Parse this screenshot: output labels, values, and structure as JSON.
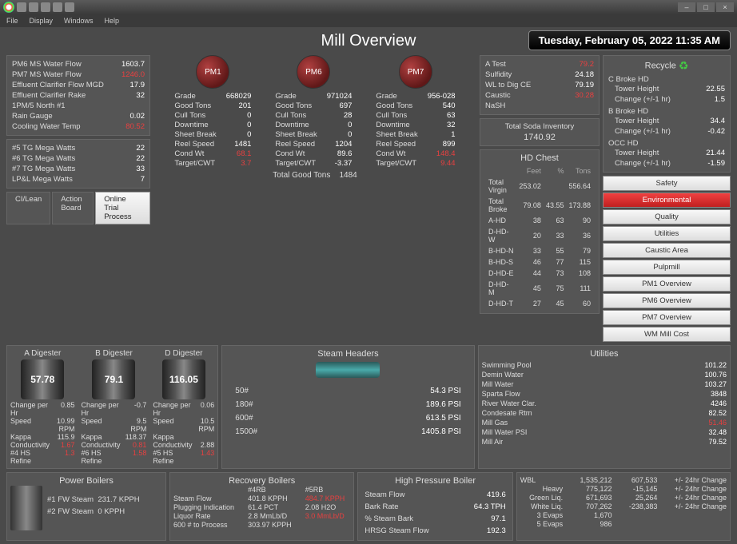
{
  "menu": {
    "file": "File",
    "display": "Display",
    "windows": "Windows",
    "help": "Help"
  },
  "title": "Mill Overview",
  "clock": "Tuesday, February 05, 2022 11:35 AM",
  "left": [
    {
      "l": "PM6 MS Water Flow",
      "v": "1603.7"
    },
    {
      "l": "PM7 MS Water Flow",
      "v": "1246.0",
      "red": true
    },
    {
      "l": "Effluent Clarifier Flow MGD",
      "v": "17.9"
    },
    {
      "l": "Effluent Clarifier Rake",
      "v": "32"
    },
    {
      "l": "1PM/5 North #1",
      "v": "",
      "red": true
    },
    {
      "l": "Rain Gauge",
      "v": "0.02"
    },
    {
      "l": "Cooling Water Temp",
      "v": "80.52",
      "red": true
    }
  ],
  "left2": [
    {
      "l": "#5 TG Mega Watts",
      "v": "22"
    },
    {
      "l": "#6 TG Mega Watts",
      "v": "22"
    },
    {
      "l": "#7 TG Mega Watts",
      "v": "33"
    },
    {
      "l": "LP&L Mega Watts",
      "v": "7"
    }
  ],
  "pm": [
    {
      "name": "PM1",
      "grade": "668029",
      "rows": [
        [
          "Good Tons",
          "201"
        ],
        [
          "Cull Tons",
          "0"
        ],
        [
          "Downtime",
          "0"
        ],
        [
          "Sheet Break",
          "0"
        ],
        [
          "Reel Speed",
          "1481"
        ],
        [
          "Cond Wt",
          "68.1",
          "red"
        ],
        [
          "Target/CWT",
          "3.7",
          "red"
        ]
      ]
    },
    {
      "name": "PM6",
      "grade": "971024",
      "rows": [
        [
          "Good Tons",
          "697"
        ],
        [
          "Cull Tons",
          "28"
        ],
        [
          "Downtime",
          "0"
        ],
        [
          "Sheet Break",
          "0"
        ],
        [
          "Reel Speed",
          "1204"
        ],
        [
          "Cond Wt",
          "89.6"
        ],
        [
          "Target/CWT",
          "-3.37"
        ]
      ]
    },
    {
      "name": "PM7",
      "grade": "956-028",
      "rows": [
        [
          "Good Tons",
          "540"
        ],
        [
          "Cull Tons",
          "63"
        ],
        [
          "Downtime",
          "32"
        ],
        [
          "Sheet Break",
          "1"
        ],
        [
          "Reel Speed",
          "899"
        ],
        [
          "Cond Wt",
          "148.4",
          "red"
        ],
        [
          "Target/CWT",
          "9.44",
          "red"
        ]
      ]
    }
  ],
  "totalgood": {
    "l": "Total Good Tons",
    "v": "1484"
  },
  "tabs": [
    "CI/Lean",
    "Action Board",
    "Online Trial Process"
  ],
  "tests": [
    {
      "l": "A Test",
      "v": "79.2",
      "red": true
    },
    {
      "l": "Sulfidity",
      "v": "24.18"
    },
    {
      "l": "WL to Dig CE",
      "v": "79.19"
    },
    {
      "l": "Caustic",
      "v": "30.28",
      "red": true
    },
    {
      "l": "NaSH",
      "v": "",
      "red": true
    }
  ],
  "soda": {
    "l": "Total Soda Inventory",
    "v": "1740.92"
  },
  "recycle": {
    "title": "Recycle",
    "items": [
      {
        "h": "C Broke HD",
        "a": "Tower Height",
        "av": "22.55",
        "b": "Change (+/-1 hr)",
        "bv": "1.5"
      },
      {
        "h": "B Broke HD",
        "a": "Tower Height",
        "av": "34.4",
        "b": "Change (+/-1 hr)",
        "bv": "-0.42"
      },
      {
        "h": "OCC HD",
        "a": "Tower Height",
        "av": "21.44",
        "b": "Change (+/-1 hr)",
        "bv": "-1.59"
      }
    ]
  },
  "hdchest": {
    "title": "HD Chest",
    "cols": [
      "",
      "Feet",
      "%",
      "Tons"
    ],
    "rows": [
      [
        "Total Virgin",
        "253.02",
        "",
        "556.64"
      ],
      [
        "Total Broke",
        "79.08",
        "43.55",
        "173.88"
      ],
      [
        "A-HD",
        "38",
        "63",
        "90"
      ],
      [
        "D-HD-W",
        "20",
        "33",
        "36"
      ],
      [
        "B-HD-N",
        "33",
        "55",
        "79"
      ],
      [
        "B-HD-S",
        "46",
        "77",
        "115"
      ],
      [
        "D-HD-E",
        "44",
        "73",
        "108"
      ],
      [
        "D-HD-M",
        "45",
        "75",
        "111"
      ],
      [
        "D-HD-T",
        "27",
        "45",
        "60"
      ]
    ]
  },
  "btns": [
    "Safety",
    "Environmental",
    "Quality",
    "Utilities",
    "Caustic Area",
    "Pulpmill",
    "PM1 Overview",
    "PM6 Overview",
    "PM7 Overview",
    "WM Mill Cost"
  ],
  "digesters": [
    {
      "name": "A Digester",
      "val": "57.78",
      "rows": [
        [
          "Change per Hr",
          "0.85"
        ],
        [
          "Speed",
          "10.99 RPM"
        ],
        [
          "Kappa",
          "115.9"
        ],
        [
          "Conductivity",
          "1.67",
          "red"
        ],
        [
          "#4 HS Refine",
          "1.3",
          "red"
        ]
      ]
    },
    {
      "name": "B Digester",
      "val": "79.1",
      "rows": [
        [
          "Change per Hr",
          "-0.7"
        ],
        [
          "Speed",
          "9.5 RPM"
        ],
        [
          "Kappa",
          "118.37"
        ],
        [
          "Conductivity",
          "0.81",
          "red"
        ],
        [
          "#6 HS Refine",
          "1.58",
          "red"
        ]
      ]
    },
    {
      "name": "D Digester",
      "val": "116.05",
      "rows": [
        [
          "Change per Hr",
          "0.06"
        ],
        [
          "Speed",
          "10.5 RPM"
        ],
        [
          "Kappa",
          "",
          "red"
        ],
        [
          "Conductivity",
          "2.88"
        ],
        [
          "#5 HS Refine",
          "1.43",
          "red"
        ]
      ]
    }
  ],
  "steam": {
    "title": "Steam Headers",
    "rows": [
      [
        "50#",
        "54.3 PSI"
      ],
      [
        "180#",
        "189.6 PSI"
      ],
      [
        "600#",
        "613.5 PSI"
      ],
      [
        "1500#",
        "1405.8 PSI"
      ]
    ]
  },
  "util": {
    "title": "Utilities",
    "rows": [
      [
        "Swimming Pool",
        "101.22"
      ],
      [
        "Demin Water",
        "100.76"
      ],
      [
        "Mill Water",
        "103.27"
      ],
      [
        "Sparta Flow",
        "3848"
      ],
      [
        "River Water Clar.",
        "4246"
      ],
      [
        "Condesate Rtrn",
        "82.52"
      ],
      [
        "Mill Gas",
        "51.46",
        "red"
      ],
      [
        "Mill Water PSI",
        "32.48"
      ],
      [
        "Mill Air",
        "79.52"
      ]
    ]
  },
  "power": {
    "title": "Power Boilers",
    "rows": [
      [
        "#1 FW Steam",
        "231.7 KPPH"
      ],
      [
        "#2 FW Steam",
        "0  KPPH"
      ]
    ]
  },
  "recovery": {
    "title": "Recovery Boilers",
    "h1": "#4RB",
    "h2": "#5RB",
    "rows": [
      [
        "Steam Flow",
        "401.8  KPPH",
        "484.7  KPPH",
        "red2"
      ],
      [
        "Plugging Indication",
        "61.4 PCT",
        "2.08 H2O"
      ],
      [
        "Liquor Rate",
        "2.8 MmLb/D",
        "3.0 MmLb/D",
        "red2"
      ],
      [
        "600 # to Process",
        "303.97 KPPH",
        ""
      ]
    ]
  },
  "hpb": {
    "title": "High Pressure Boiler",
    "rows": [
      [
        "Steam Flow",
        "419.6"
      ],
      [
        "Bark Rate",
        "64.3 TPH"
      ],
      [
        "% Steam Bark",
        "97.1"
      ],
      [
        "HRSG Steam Flow",
        "192.3"
      ]
    ]
  },
  "liq": {
    "rows": [
      [
        "WBL",
        "1,535,212",
        "607,533",
        "+/- 24hr Change"
      ],
      [
        "Heavy",
        "775,122",
        "-15,145",
        "+/- 24hr Change"
      ],
      [
        "Green Liq.",
        "671,693",
        "25,264",
        "+/- 24hr Change"
      ],
      [
        "White Liq.",
        "707,262",
        "-238,383",
        "+/- 24hr Change"
      ],
      [
        "3 Evaps",
        "1,670",
        "",
        ""
      ],
      [
        "5 Evaps",
        "986",
        "",
        ""
      ]
    ]
  }
}
